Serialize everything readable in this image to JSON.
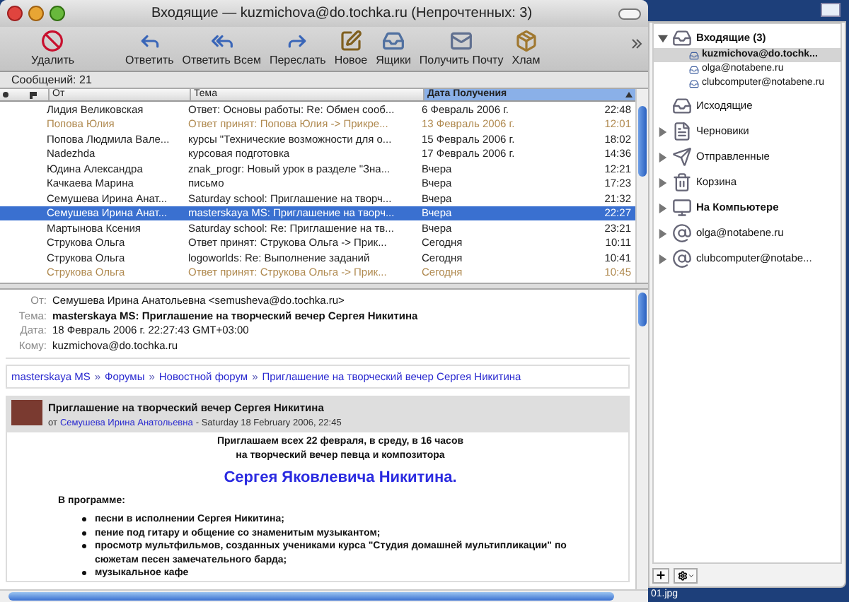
{
  "window": {
    "title": "Входящие — kuzmichova@do.tochka.ru (Непрочтенных: 3)"
  },
  "toolbar": [
    {
      "kind": "delete",
      "label": "Удалить"
    },
    {
      "kind": "reply",
      "label": "Ответить"
    },
    {
      "kind": "reply_all",
      "label": "Ответить Всем"
    },
    {
      "kind": "forward",
      "label": "Переслать"
    },
    {
      "kind": "new",
      "label": "Новое"
    },
    {
      "kind": "mailboxes",
      "label": "Ящики"
    },
    {
      "kind": "get_mail",
      "label": "Получить Почту"
    },
    {
      "kind": "junk",
      "label": "Хлам"
    }
  ],
  "message_count": "Сообщений: 21",
  "table": {
    "columns": [
      {
        "label": "От",
        "selected": false
      },
      {
        "label": "Тема",
        "selected": false
      },
      {
        "label": "Дата Получения",
        "selected": true
      }
    ],
    "rows": [
      {
        "from": "Лидия Великовская",
        "subject": "Ответ: Основы работы: Re: Обмен сооб...",
        "date": "6 Февраль 2006 г.",
        "time": "22:48",
        "replied": false,
        "selected": false
      },
      {
        "from": "Попова Юлия",
        "subject": "Ответ принят: Попова Юлия -> Прикре...",
        "date": "13 Февраль 2006 г.",
        "time": "12:01",
        "replied": true,
        "selected": false
      },
      {
        "from": "Попова Людмила Вале...",
        "subject": "курсы \"Технические возможности для о...",
        "date": "15 Февраль 2006 г.",
        "time": "18:02",
        "replied": false,
        "selected": false
      },
      {
        "from": "Nadezhda",
        "subject": "курсовая подготовка",
        "date": "17 Февраль 2006 г.",
        "time": "14:36",
        "replied": false,
        "selected": false
      },
      {
        "from": "Юдина Александра",
        "subject": "znak_progr: Новый урок в разделе \"Зна...",
        "date": "Вчера",
        "time": "12:21",
        "replied": false,
        "selected": false
      },
      {
        "from": "Качкаева Марина",
        "subject": "письмо",
        "date": "Вчера",
        "time": "17:23",
        "replied": false,
        "selected": false
      },
      {
        "from": "Семушева Ирина Анат...",
        "subject": "Saturday school: Приглашение на творч...",
        "date": "Вчера",
        "time": "21:32",
        "replied": false,
        "selected": false
      },
      {
        "from": "Семушева Ирина Анат...",
        "subject": "masterskaya MS: Приглашение на творч...",
        "date": "Вчера",
        "time": "22:27",
        "replied": false,
        "selected": true
      },
      {
        "from": "Мартынова Ксения",
        "subject": "Saturday school: Re: Приглашение на тв...",
        "date": "Вчера",
        "time": "23:21",
        "replied": false,
        "selected": false
      },
      {
        "from": "Струкова Ольга",
        "subject": "Ответ принят: Струкова Ольга -> Прик...",
        "date": "Сегодня",
        "time": "10:11",
        "replied": false,
        "selected": false
      },
      {
        "from": "Струкова Ольга",
        "subject": "logoworlds: Re: Выполнение заданий",
        "date": "Сегодня",
        "time": "10:41",
        "replied": false,
        "selected": false
      },
      {
        "from": "Струкова Ольга",
        "subject": "Ответ принят: Струкова Ольга -> Прик...",
        "date": "Сегодня",
        "time": "10:45",
        "replied": true,
        "selected": false
      }
    ]
  },
  "headers": [
    {
      "label": "От:",
      "value": "Семушева Ирина Анатольевна <semusheva@do.tochka.ru>",
      "bold": false
    },
    {
      "label": "Тема:",
      "value": "masterskaya MS: Приглашение на творческий вечер Сергея Никитина",
      "bold": true
    },
    {
      "label": "Дата:",
      "value": "18 Февраль 2006 г. 22:27:43 GMT+03:00",
      "bold": false
    },
    {
      "label": "Кому:",
      "value": "kuzmichova@do.tochka.ru",
      "bold": false
    }
  ],
  "breadcrumb": [
    {
      "kind": "link",
      "text": "masterskaya MS"
    },
    {
      "kind": "sep",
      "text": "»"
    },
    {
      "kind": "link",
      "text": "Форумы"
    },
    {
      "kind": "sep",
      "text": "»"
    },
    {
      "kind": "link",
      "text": "Новостной форум"
    },
    {
      "kind": "sep",
      "text": "»"
    },
    {
      "kind": "link",
      "text": "Приглашение на творческий вечер Сергея Никитина"
    }
  ],
  "post": {
    "title": "Приглашение на творческий вечер Сергея Никитина",
    "by": "от",
    "author": "Семушева Ирина Анатольевна",
    "date": "- Saturday 18 February 2006, 22:45",
    "intro": [
      "Приглашаем всех 22 февраля, в среду, в 16 часов",
      "на творческий вечер певца и композитора"
    ],
    "headline": "Сергея Яковлевича Никитина.",
    "program_label": "В программе:",
    "items": [
      "песни в исполнении Сергея Никитина;",
      "пение под гитару и общение со знаменитым музыкантом;",
      "просмотр мультфильмов, созданных учениками курса \"Студия домашней мультипликации\" по сюжетам песен замечательного барда;",
      "музыкальное кафе"
    ]
  },
  "sidebar": {
    "items": [
      {
        "kind": "inbox",
        "label": "Входящие (3)",
        "bold": true,
        "expanded": true,
        "children": [
          {
            "label": "kuzmichova@do.tochk...",
            "selected": true
          },
          {
            "label": "olga@notabene.ru",
            "selected": false
          },
          {
            "label": "clubcomputer@notabene.ru",
            "selected": false
          }
        ]
      },
      {
        "kind": "outbox",
        "label": "Исходящие",
        "bold": false
      },
      {
        "kind": "drafts",
        "label": "Черновики",
        "bold": false,
        "expanded": false
      },
      {
        "kind": "sent",
        "label": "Отправленные",
        "bold": false,
        "expanded": false
      },
      {
        "kind": "trash",
        "label": "Корзина",
        "bold": false,
        "expanded": false
      },
      {
        "kind": "computer",
        "label": "На Компьютере",
        "bold": true,
        "expanded": false
      },
      {
        "kind": "account",
        "label": "olga@notabene.ru",
        "bold": false,
        "expanded": false
      },
      {
        "kind": "account",
        "label": "clubcomputer@notabe...",
        "bold": false,
        "expanded": false
      }
    ]
  },
  "desktop": {
    "file_label": "01.jpg"
  }
}
